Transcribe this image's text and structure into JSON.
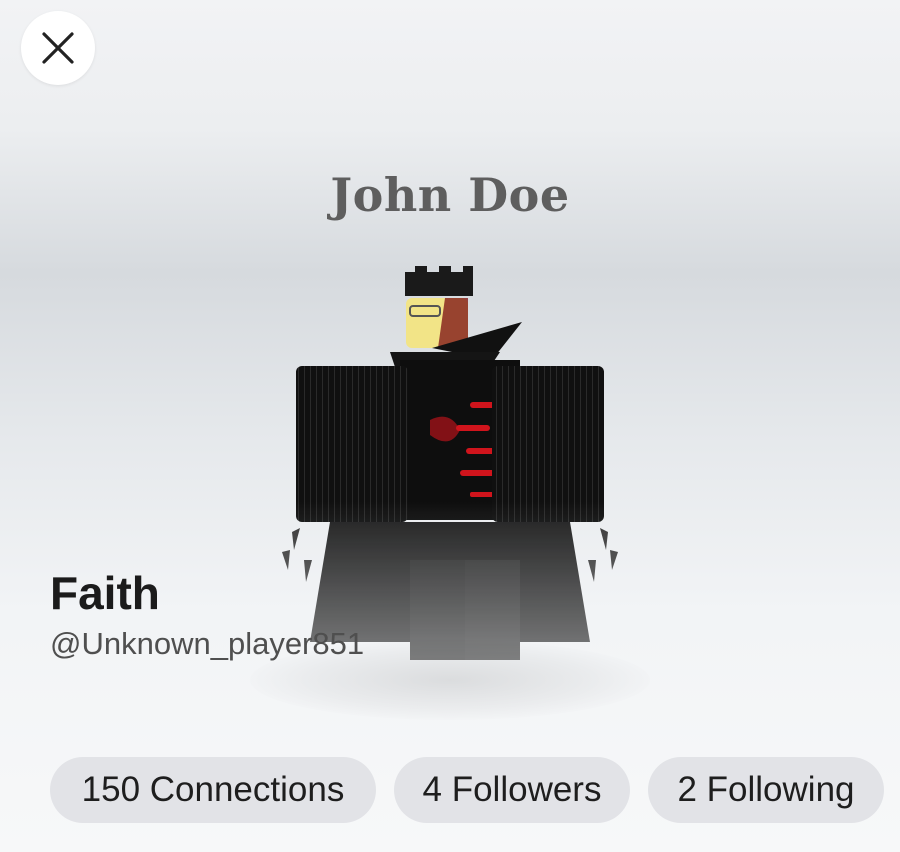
{
  "profile": {
    "avatar_nameplate": "John Doe",
    "display_name": "Faith",
    "username": "@Unknown_player851"
  },
  "stats": {
    "connections": "150 Connections",
    "followers": "4 Followers",
    "following": "2 Following"
  },
  "icons": {
    "close": "close-icon"
  },
  "colors": {
    "stat_pill_bg": "#e2e3e7",
    "accent_red": "#d0141c"
  }
}
